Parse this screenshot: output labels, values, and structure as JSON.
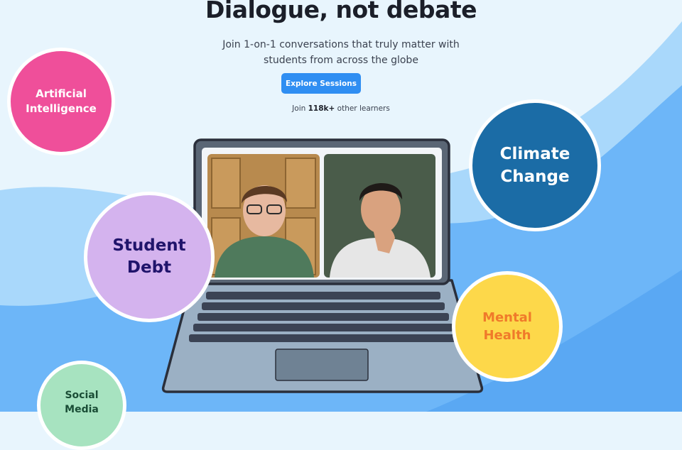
{
  "hero": {
    "title": "Dialogue, not debate",
    "subtitle_line1": "Join 1-on-1 conversations that truly matter with",
    "subtitle_line2": "students from across the globe",
    "cta_label": "Explore Sessions",
    "join_prefix": "Join",
    "join_count": "118k+",
    "join_suffix": "other learners"
  },
  "topics": {
    "ai": {
      "line1": "Artificial",
      "line2": "Intelligence"
    },
    "climate": {
      "line1": "Climate",
      "line2": "Change"
    },
    "debt": {
      "line1": "Student",
      "line2": "Debt"
    },
    "mental": {
      "line1": "Mental",
      "line2": "Health"
    },
    "social": {
      "line1": "Social",
      "line2": "Media"
    }
  },
  "colors": {
    "cta": "#2f8ef2",
    "ai_bubble": "#ef4f9a",
    "climate_bubble": "#1b6ca6",
    "debt_bubble": "#d4b3ee",
    "mental_bubble": "#fdd84a",
    "social_bubble": "#a7e3c0",
    "wave_light": "#a9d8fb",
    "wave_mid": "#6db6f8"
  },
  "illustration": {
    "laptop": "laptop-icon",
    "participants": [
      "participant-left",
      "participant-right"
    ]
  }
}
